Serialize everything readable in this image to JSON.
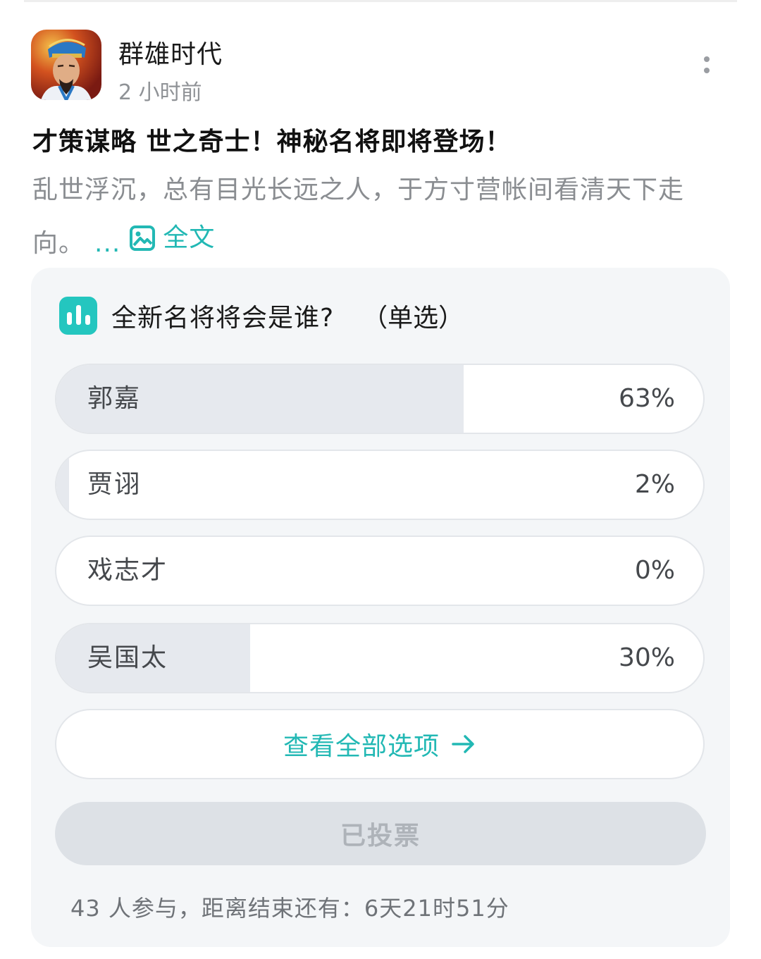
{
  "post": {
    "author": "群雄时代",
    "time": "2 小时前",
    "title": "才策谋略 世之奇士！神秘名将即将登场！",
    "excerpt": "乱世浮沉，总有目光长远之人，于方寸营帐间看清天下走向。",
    "ellipsis": "...",
    "full_text_label": "全文"
  },
  "poll": {
    "question": "全新名将将会是谁?",
    "mode": "（单选）",
    "options": [
      {
        "label": "郭嘉",
        "percent": "63%",
        "fraction": 0.63
      },
      {
        "label": "贾诩",
        "percent": "2%",
        "fraction": 0.02
      },
      {
        "label": "戏志才",
        "percent": "0%",
        "fraction": 0
      },
      {
        "label": "吴国太",
        "percent": "30%",
        "fraction": 0.3
      }
    ],
    "view_all_label": "查看全部选项",
    "voted_label": "已投票",
    "footer": "43 人参与，距离结束还有：6天21时51分"
  },
  "colors": {
    "accent": "#22b8b4",
    "poll_icon_bg": "#24c6bf",
    "option_fill": "#e6e9ee",
    "card_bg": "#f4f6f8"
  },
  "icons": [
    "more-vertical-icon",
    "image-icon",
    "poll-chart-icon",
    "arrow-right-icon"
  ]
}
